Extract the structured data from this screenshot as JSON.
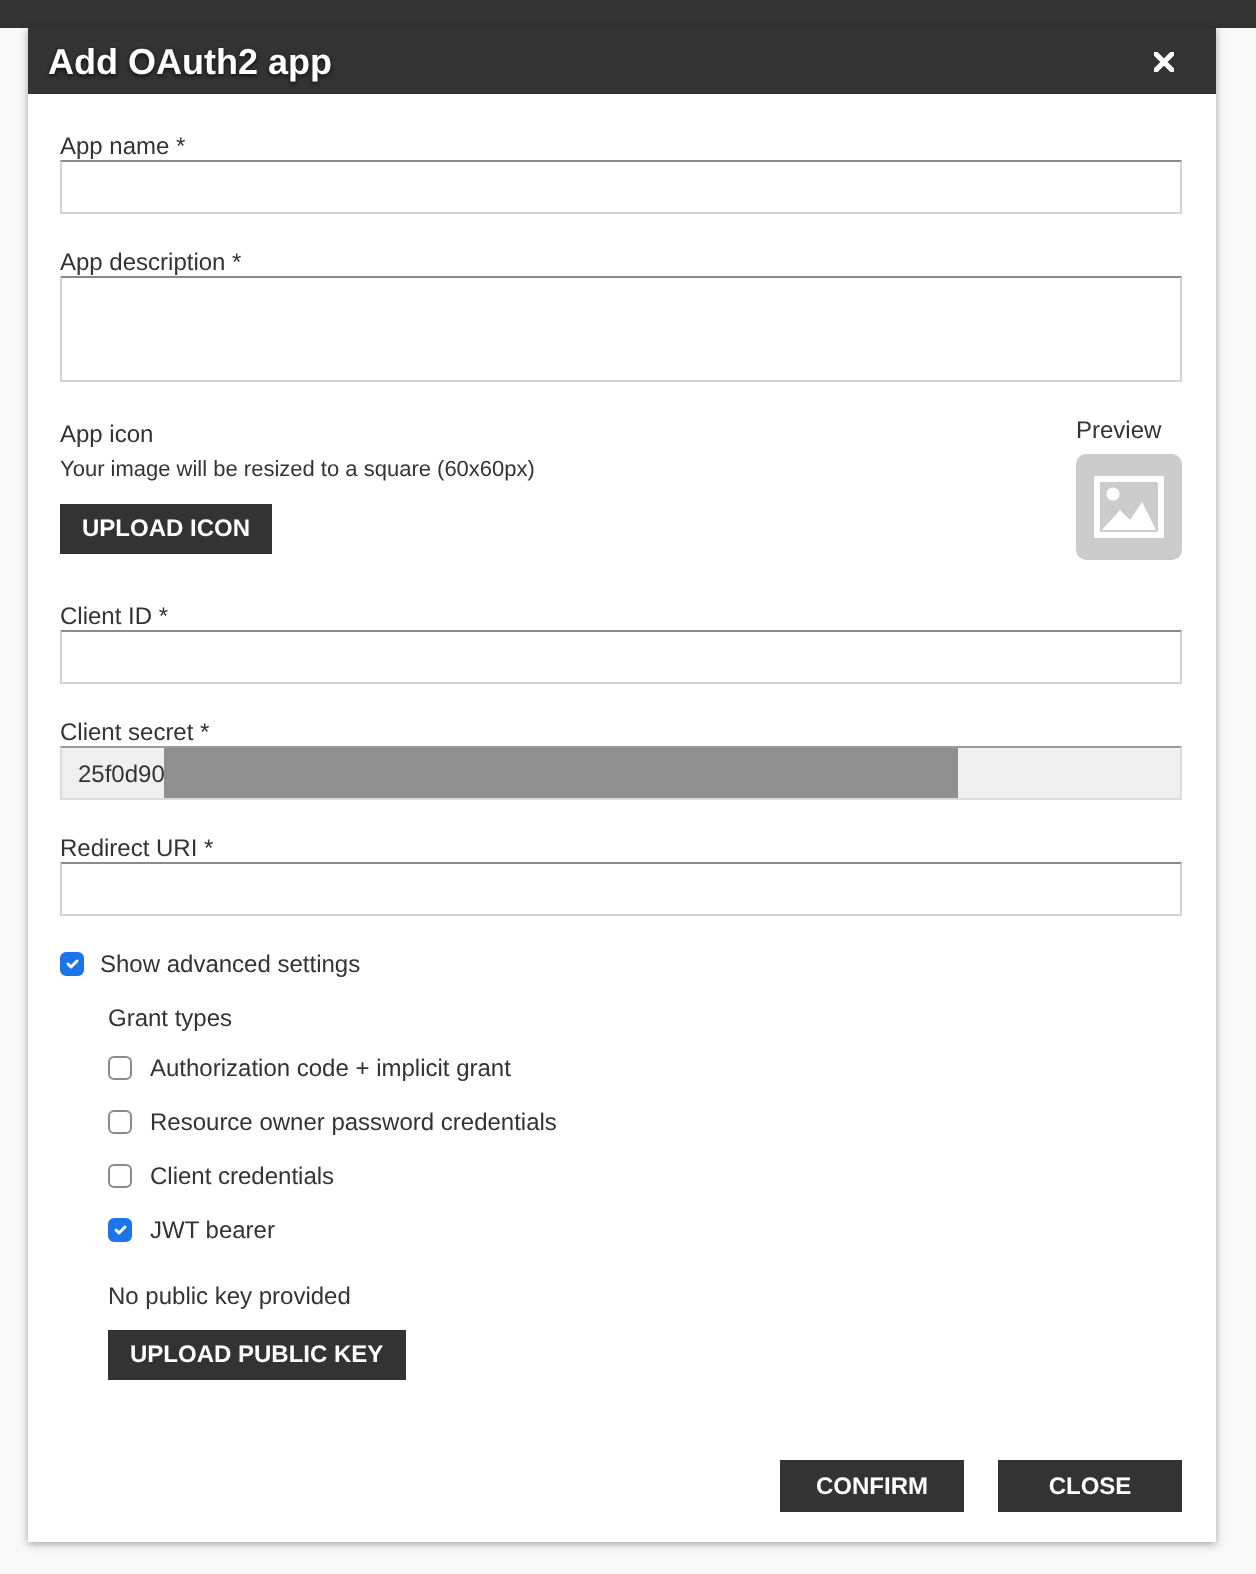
{
  "dialog": {
    "title": "Add OAuth2 app"
  },
  "app_fields": [
    {
      "kind": "input",
      "label": "App name *",
      "readonly": false,
      "redacted": false
    },
    {
      "kind": "textarea",
      "label": "App description *",
      "readonly": false,
      "redacted": false
    }
  ],
  "app_icon": {
    "label": "App icon",
    "hint": "Your image will be resized to a square (60x60px)",
    "button": "UPLOAD ICON",
    "preview_label": "Preview"
  },
  "client_fields": [
    {
      "kind": "input",
      "label": "Client ID *",
      "readonly": false,
      "redacted": false
    },
    {
      "kind": "input",
      "label": "Client secret *",
      "value": "25f0d90",
      "readonly": true,
      "redacted": true
    },
    {
      "kind": "input",
      "label": "Redirect URI *",
      "readonly": false,
      "redacted": false
    }
  ],
  "advanced": {
    "label": "Show advanced settings",
    "checked": true,
    "grant_types_label": "Grant types",
    "grant_types": [
      {
        "label": "Authorization code + implicit grant",
        "checked": false
      },
      {
        "label": "Resource owner password credentials",
        "checked": false
      },
      {
        "label": "Client credentials",
        "checked": false
      },
      {
        "label": "JWT bearer",
        "checked": true
      }
    ],
    "public_key_status": "No public key provided",
    "upload_button": "UPLOAD PUBLIC KEY"
  },
  "buttons": [
    {
      "label": "CONFIRM"
    },
    {
      "label": "CLOSE"
    }
  ]
}
